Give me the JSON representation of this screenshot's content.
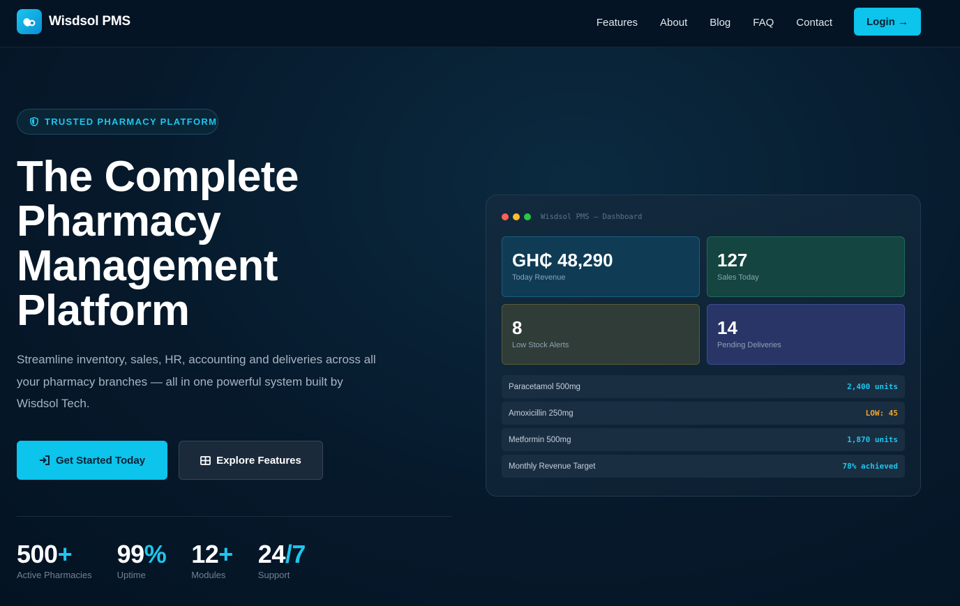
{
  "nav": {
    "brand": "Wisdsol PMS",
    "links": [
      "Features",
      "About",
      "Blog",
      "FAQ",
      "Contact"
    ],
    "login": "Login →"
  },
  "hero": {
    "badge": "TRUSTED PHARMACY PLATFORM",
    "title_lines": [
      "The Complete",
      "Pharmacy",
      "Management",
      "Platform"
    ],
    "description": "Streamline inventory, sales, HR, accounting and deliveries across all your pharmacy branches — all in one powerful system built by Wisdsol Tech.",
    "primary_button": "Get Started Today",
    "secondary_button": "Explore Features"
  },
  "stats": [
    {
      "value": "500",
      "accent": "+",
      "label": "Active Pharmacies"
    },
    {
      "value": "99",
      "accent": "%",
      "label": "Uptime"
    },
    {
      "value": "12",
      "accent": "+",
      "label": "Modules"
    },
    {
      "value": "24",
      "accent": "/7",
      "label": "Support"
    }
  ],
  "dashboard": {
    "title": "Wisdsol PMS — Dashboard",
    "tiles": [
      {
        "value": "GH₵ 48,290",
        "label": "Today Revenue"
      },
      {
        "value": "127",
        "label": "Sales Today"
      },
      {
        "value": "8",
        "label": "Low Stock Alerts"
      },
      {
        "value": "14",
        "label": "Pending Deliveries"
      }
    ],
    "rows": [
      {
        "name": "Paracetamol 500mg",
        "value": "2,400 units",
        "color": "#1ec6ee"
      },
      {
        "name": "Amoxicillin 250mg",
        "value": "LOW: 45",
        "color": "#f2a52a"
      },
      {
        "name": "Metformin 500mg",
        "value": "1,870 units",
        "color": "#1ec6ee"
      },
      {
        "name": "Monthly Revenue Target",
        "value": "78% achieved",
        "color": "#1ec6ee"
      }
    ]
  },
  "colors": {
    "accent": "#0cc4ec",
    "background": "#06192b",
    "warning": "#f2a52a"
  }
}
